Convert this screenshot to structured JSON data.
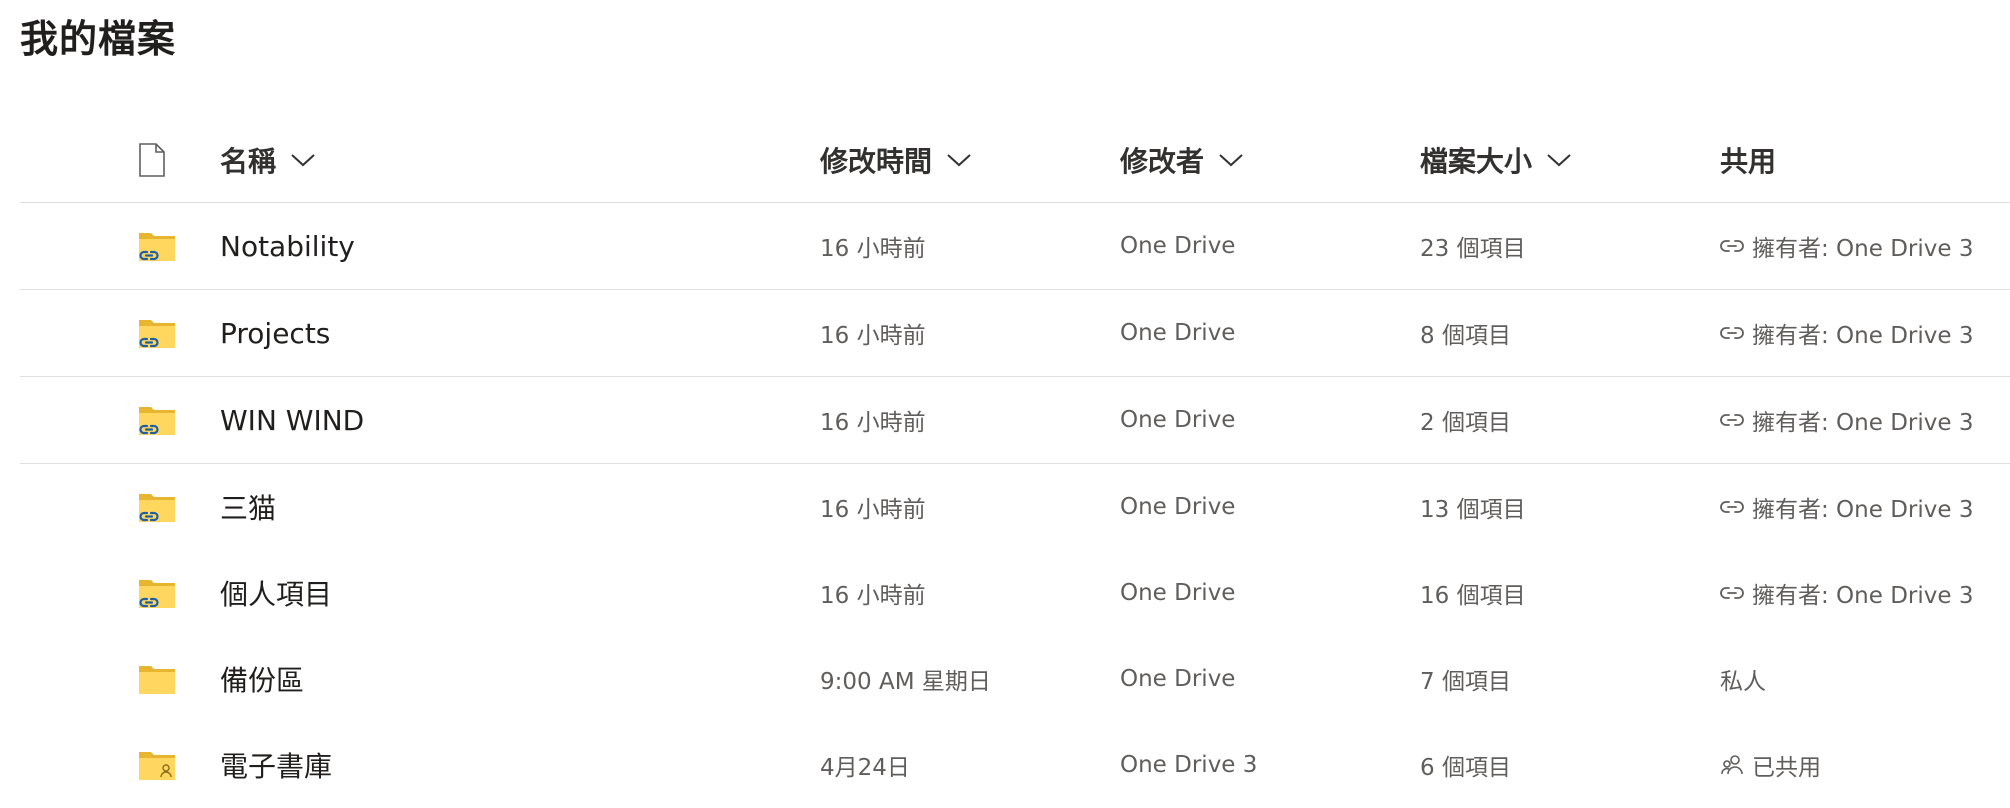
{
  "page": {
    "title": "我的檔案"
  },
  "columns": {
    "name": "名稱",
    "modified": "修改時間",
    "modified_by": "修改者",
    "size": "檔案大小",
    "sharing": "共用"
  },
  "rows": [
    {
      "name": "Notability",
      "modified": "16 小時前",
      "modified_by": "One Drive",
      "size": "23 個項目",
      "sharing": "擁有者: One Drive 3",
      "icon": "shared-link-folder-icon",
      "share_icon": "link-icon"
    },
    {
      "name": "Projects",
      "modified": "16 小時前",
      "modified_by": "One Drive",
      "size": "8 個項目",
      "sharing": "擁有者: One Drive 3",
      "icon": "shared-link-folder-icon",
      "share_icon": "link-icon"
    },
    {
      "name": "WIN WIND",
      "modified": "16 小時前",
      "modified_by": "One Drive",
      "size": "2 個項目",
      "sharing": "擁有者: One Drive 3",
      "icon": "shared-link-folder-icon",
      "share_icon": "link-icon"
    },
    {
      "name": "三猫",
      "modified": "16 小時前",
      "modified_by": "One Drive",
      "size": "13 個項目",
      "sharing": "擁有者: One Drive 3",
      "icon": "shared-link-folder-icon",
      "share_icon": "link-icon"
    },
    {
      "name": "個人項目",
      "modified": "16 小時前",
      "modified_by": "One Drive",
      "size": "16 個項目",
      "sharing": "擁有者: One Drive 3",
      "icon": "shared-link-folder-icon",
      "share_icon": "link-icon"
    },
    {
      "name": "備份區",
      "modified": "9:00 AM 星期日",
      "modified_by": "One Drive",
      "size": "7 個項目",
      "sharing": "私人",
      "icon": "folder-icon",
      "share_icon": ""
    },
    {
      "name": "電子書庫",
      "modified": "4月24日",
      "modified_by": "One Drive 3",
      "size": "6 個項目",
      "sharing": "已共用",
      "icon": "shared-people-folder-icon",
      "share_icon": "people-icon"
    }
  ],
  "colors": {
    "folder": "#ffd75e",
    "folder_tab": "#e8b531",
    "link_badge": "#1f5fa8",
    "divider": "#e1dfdd"
  }
}
